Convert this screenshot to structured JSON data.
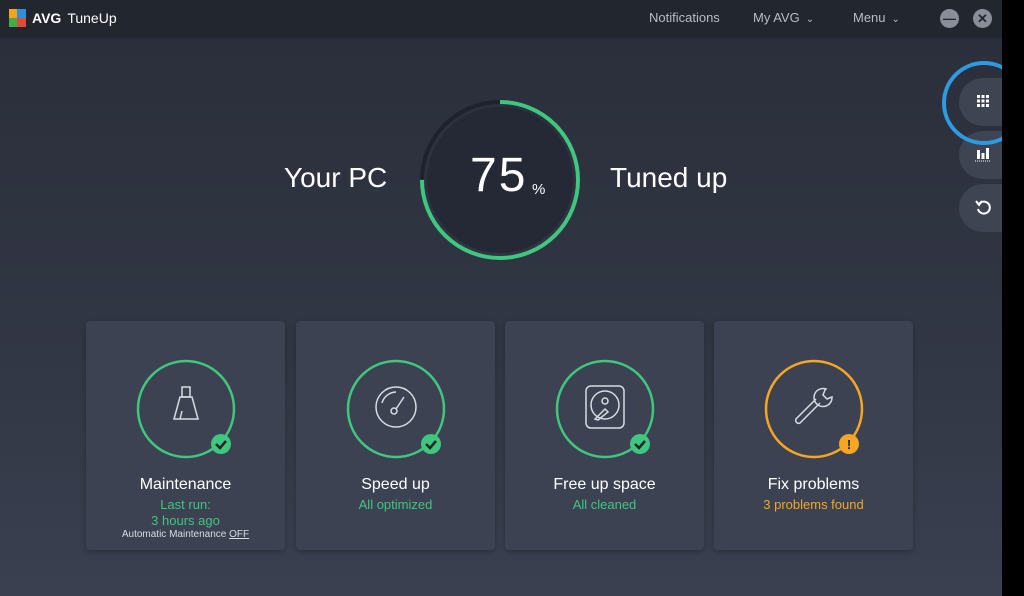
{
  "app": {
    "brand": "AVG",
    "product": "TuneUp"
  },
  "header": {
    "notifications_label": "Notifications",
    "myavg_label": "My AVG",
    "menu_label": "Menu",
    "minimize_icon": "minus-icon",
    "close_icon": "x-icon"
  },
  "hero": {
    "left_text": "Your PC",
    "right_text": "Tuned up",
    "percent_value": "75",
    "percent_sign": "%",
    "progress_fraction": 0.75,
    "progress_color": "#3fc67f"
  },
  "side_buttons": [
    {
      "name": "apps-grid",
      "icon": "grid-icon"
    },
    {
      "name": "performance-chart",
      "icon": "bar-chart-icon"
    },
    {
      "name": "undo",
      "icon": "undo-icon"
    }
  ],
  "cards": [
    {
      "title": "Maintenance",
      "status_line1": "Last run:",
      "status_line2": "3 hours ago",
      "auto_label": "Automatic Maintenance",
      "auto_value": "OFF",
      "icon": "broom-icon",
      "state": "ok",
      "color": "#3fc67f"
    },
    {
      "title": "Speed up",
      "status_line1": "All optimized",
      "icon": "speedometer-icon",
      "state": "ok",
      "color": "#3fc67f"
    },
    {
      "title": "Free up space",
      "status_line1": "All cleaned",
      "icon": "hard-disk-icon",
      "state": "ok",
      "color": "#3fc67f"
    },
    {
      "title": "Fix problems",
      "status_line1": "3 problems found",
      "icon": "wrench-icon",
      "state": "warning",
      "color": "#f5a623"
    }
  ]
}
